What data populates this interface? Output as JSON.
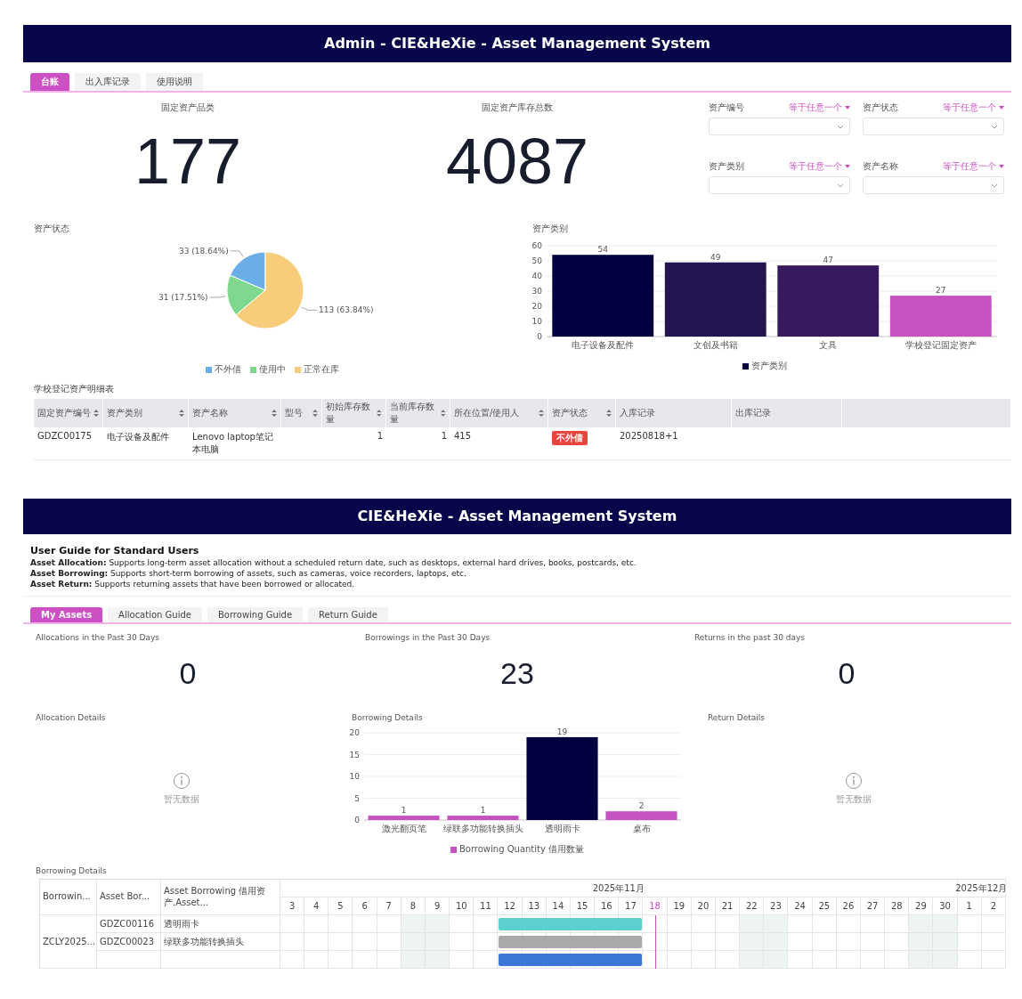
{
  "admin": {
    "title": "Admin - CIE&HeXie - Asset Management System",
    "tabs": [
      {
        "label": "台账",
        "selected": true
      },
      {
        "label": "出入库记录",
        "selected": false
      },
      {
        "label": "使用说明",
        "selected": false
      }
    ],
    "stats": [
      {
        "label": "固定资产品类",
        "value": "177"
      },
      {
        "label": "固定资产库存总数",
        "value": "4087"
      }
    ],
    "filters": [
      {
        "label": "资产编号",
        "operator": "等于任意一个"
      },
      {
        "label": "资产状态",
        "operator": "等于任意一个"
      },
      {
        "label": "资产类别",
        "operator": "等于任意一个"
      },
      {
        "label": "资产名称",
        "operator": "等于任意一个"
      }
    ],
    "status_chart": {
      "title": "资产状态",
      "chart_data": {
        "type": "pie",
        "categories": [
          "不外借",
          "使用中",
          "正常在库"
        ],
        "values": [
          33,
          31,
          113
        ],
        "colors": [
          "#6aaee8",
          "#7ed88e",
          "#f7cd7c"
        ],
        "value_labels": [
          "33 (18.64%)",
          "31 (17.51%)",
          "113 (63.84%)"
        ],
        "legend": "bottom"
      }
    },
    "category_chart": {
      "title": "资产类别",
      "legend_swatch": {
        "color": "#02003f"
      },
      "chart_data": {
        "type": "bar",
        "categories": [
          "电子设备及配件",
          "文创及书籍",
          "文具",
          "学校登记固定资产"
        ],
        "series": [
          {
            "name": "资产类别",
            "values": [
              54,
              49,
              47,
              27
            ]
          }
        ],
        "colors": [
          "#02003f",
          "#24144f",
          "#371a5e",
          "#c452c0"
        ],
        "ylim": [
          0,
          60
        ],
        "yticks": [
          0,
          10,
          20,
          30,
          40,
          50,
          60
        ],
        "data_labels": true,
        "grid": true,
        "legend": "bottom"
      }
    },
    "table": {
      "title": "学校登记资产明细表",
      "columns": [
        "固定资产编号",
        "资产类别",
        "资产名称",
        "型号",
        "初始库存数量",
        "当前库存数量",
        "所在位置/使用人",
        "资产状态",
        "入库记录",
        "出库记录"
      ],
      "rows": [
        {
          "id": "GDZC00175",
          "category": "电子设备及配件",
          "name": "Lenovo laptop笔记本电脑",
          "initial": "1",
          "current": "1",
          "location": "415",
          "status": {
            "label": "不外借",
            "color": "#e8453c"
          },
          "in_record": "20250818+1"
        }
      ]
    }
  },
  "user": {
    "title": "CIE&HeXie - Asset Management System",
    "guide_title": "User Guide for Standard Users",
    "guide_lines": [
      "**Asset Allocation:** Supports long-term asset allocation without a scheduled return date, such as desktops, external hard drives, books, postcards, etc.",
      "**Asset Borrowing:** Supports short-term borrowing of assets, such as cameras, voice recorders, laptops, etc.",
      "**Asset Return:** Supports returning assets that have been borrowed or allocated."
    ],
    "tabs": [
      {
        "label": "My Assets",
        "selected": true
      },
      {
        "label": "Allocation Guide",
        "selected": false
      },
      {
        "label": "Borrowing Guide",
        "selected": false
      },
      {
        "label": "Return Guide",
        "selected": false
      }
    ],
    "stats": [
      {
        "label": "Allocations in the Past 30 Days",
        "value": "0"
      },
      {
        "label": "Borrowings in the Past 30 Days",
        "value": "23"
      },
      {
        "label": "Returns in the past 30 days",
        "value": "0"
      }
    ],
    "details": [
      {
        "kind": "empty",
        "title": "Allocation Details",
        "message": "暂无数据"
      },
      {
        "kind": "chart",
        "title": "Borrowing Details",
        "legend_swatch": {
          "color": "#c452c0"
        },
        "chart_data": {
          "type": "bar",
          "categories": [
            "激光翻页笔",
            "绿联多功能转换插头",
            "透明雨卡",
            "桌布"
          ],
          "series": [
            {
              "name": "Borrowing Quantity 借用数量",
              "values": [
                1,
                1,
                19,
                2
              ]
            }
          ],
          "colors": [
            "#c452c0",
            "#c452c0",
            "#02003f",
            "#c452c0"
          ],
          "ylim": [
            0,
            20
          ],
          "yticks": [
            0,
            5,
            10,
            15,
            20
          ],
          "data_labels": true,
          "grid": true,
          "legend": "bottom"
        }
      },
      {
        "kind": "empty",
        "title": "Return Details",
        "message": "暂无数据"
      }
    ],
    "gantt": {
      "title": "Borrowing Details",
      "columns": [
        "Borrowin...",
        "Asset Bor...",
        "Asset Borrowing 借用资产.Asset..."
      ],
      "months": [
        {
          "label": "2025年11月",
          "days": [
            {
              "day": "3",
              "weekend": false,
              "today": false
            },
            {
              "day": "4",
              "weekend": false,
              "today": false
            },
            {
              "day": "5",
              "weekend": false,
              "today": false
            },
            {
              "day": "6",
              "weekend": false,
              "today": false
            },
            {
              "day": "7",
              "weekend": false,
              "today": false
            },
            {
              "day": "8",
              "weekend": true,
              "today": false
            },
            {
              "day": "9",
              "weekend": true,
              "today": false
            },
            {
              "day": "10",
              "weekend": false,
              "today": false
            },
            {
              "day": "11",
              "weekend": false,
              "today": false
            },
            {
              "day": "12",
              "weekend": false,
              "today": false
            },
            {
              "day": "13",
              "weekend": false,
              "today": false
            },
            {
              "day": "14",
              "weekend": false,
              "today": false
            },
            {
              "day": "15",
              "weekend": false,
              "today": false
            },
            {
              "day": "16",
              "weekend": false,
              "today": false
            },
            {
              "day": "17",
              "weekend": false,
              "today": false
            },
            {
              "day": "18",
              "weekend": false,
              "today": true
            },
            {
              "day": "19",
              "weekend": false,
              "today": false
            },
            {
              "day": "20",
              "weekend": false,
              "today": false
            },
            {
              "day": "21",
              "weekend": false,
              "today": false
            },
            {
              "day": "22",
              "weekend": true,
              "today": false
            },
            {
              "day": "23",
              "weekend": true,
              "today": false
            },
            {
              "day": "24",
              "weekend": false,
              "today": false
            },
            {
              "day": "25",
              "weekend": false,
              "today": false
            },
            {
              "day": "26",
              "weekend": false,
              "today": false
            },
            {
              "day": "27",
              "weekend": false,
              "today": false
            },
            {
              "day": "28",
              "weekend": false,
              "today": false
            },
            {
              "day": "29",
              "weekend": true,
              "today": false
            },
            {
              "day": "30",
              "weekend": true,
              "today": false
            }
          ]
        },
        {
          "label": "2025年12月",
          "days": [
            {
              "day": "1",
              "weekend": false,
              "today": false
            },
            {
              "day": "2",
              "weekend": false,
              "today": false
            }
          ]
        }
      ],
      "groups": [
        {
          "label": "ZCLY2025...",
          "items": [
            {
              "code": "GDZC00116",
              "name": "透明雨卡",
              "color": "#5ccfcf",
              "booked": [
                false,
                false,
                false,
                false,
                false,
                false,
                false,
                false,
                false,
                true,
                true,
                true,
                true,
                true,
                true,
                false,
                false,
                false,
                false,
                false,
                false,
                false,
                false,
                false,
                false,
                false,
                false,
                false,
                false,
                false
              ]
            },
            {
              "code": "GDZC00023",
              "name": "绿联多功能转换插头",
              "color": "#a9a9a9",
              "booked": [
                false,
                false,
                false,
                false,
                false,
                false,
                false,
                false,
                false,
                true,
                true,
                true,
                true,
                true,
                true,
                false,
                false,
                false,
                false,
                false,
                false,
                false,
                false,
                false,
                false,
                false,
                false,
                false,
                false,
                false
              ]
            },
            {
              "color": "#3a78d8",
              "booked": [
                false,
                false,
                false,
                false,
                false,
                false,
                false,
                false,
                false,
                true,
                true,
                true,
                true,
                true,
                true,
                false,
                false,
                false,
                false,
                false,
                false,
                false,
                false,
                false,
                false,
                false,
                false,
                false,
                false,
                false
              ]
            }
          ]
        }
      ]
    }
  }
}
